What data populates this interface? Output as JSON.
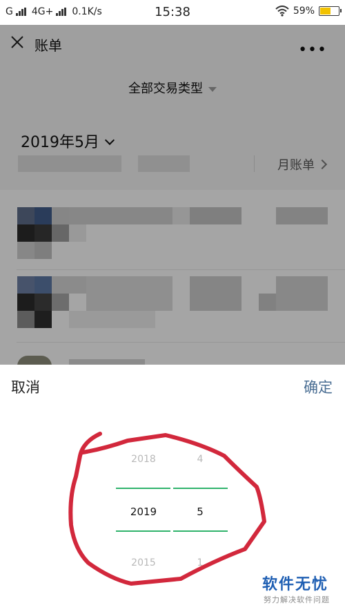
{
  "status": {
    "carrier": "G",
    "network": "4G+",
    "speed": "0.1K/s",
    "time": "15:38",
    "battery": "59%",
    "battery_level": 0.59
  },
  "header": {
    "title": "账单",
    "more": "•••"
  },
  "filter": {
    "label": "全部交易类型"
  },
  "summary": {
    "month": "2019年5月",
    "monthly_bill": "月账单"
  },
  "picker": {
    "cancel": "取消",
    "confirm": "确定",
    "year_above": "2018",
    "year_selected": "2019",
    "year_below": "2015",
    "month_above": "4",
    "month_selected": "5",
    "month_below": "1"
  },
  "colors": {
    "accent_green": "#2fb36b",
    "confirm_blue": "#4a6e93",
    "annotation_red": "#d2283c"
  },
  "watermark": {
    "title": "软件无忧",
    "subtitle": "努力解决软件问题"
  }
}
